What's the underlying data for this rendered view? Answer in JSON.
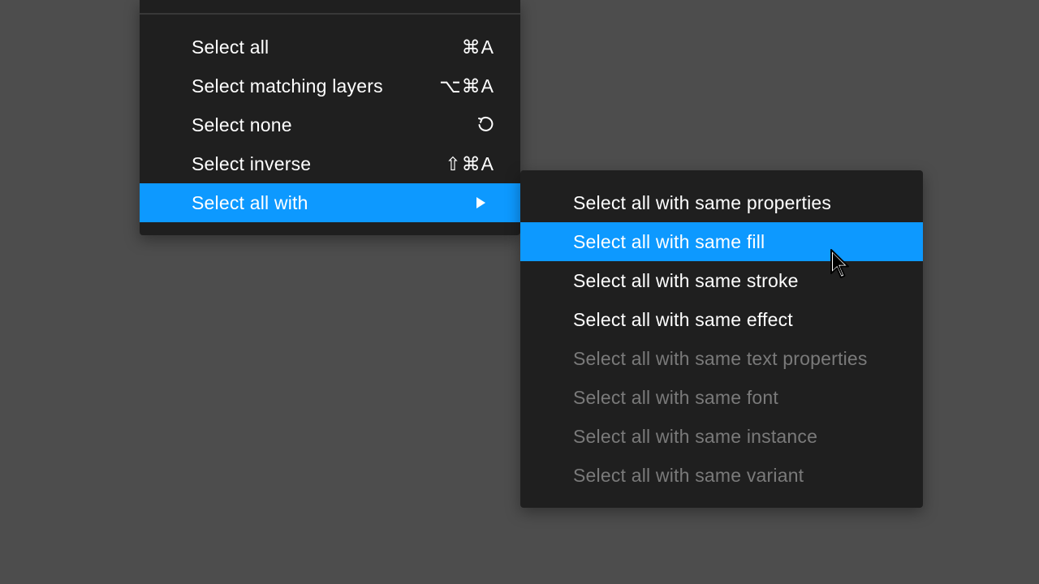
{
  "main_menu": {
    "items": [
      {
        "label": "Select all",
        "shortcut": "⌘A",
        "state": "normal"
      },
      {
        "label": "Select matching layers",
        "shortcut": "⌥⌘A",
        "state": "normal"
      },
      {
        "label": "Select none",
        "shortcut_icon": "undo-icon",
        "state": "normal"
      },
      {
        "label": "Select inverse",
        "shortcut": "⇧⌘A",
        "state": "normal"
      },
      {
        "label": "Select all with",
        "submenu_icon": "triangle-right-icon",
        "state": "highlighted"
      }
    ]
  },
  "submenu": {
    "items": [
      {
        "label": "Select all with same properties",
        "state": "normal"
      },
      {
        "label": "Select all with same fill",
        "state": "highlighted"
      },
      {
        "label": "Select all with same stroke",
        "state": "normal"
      },
      {
        "label": "Select all with same effect",
        "state": "normal"
      },
      {
        "label": "Select all with same text properties",
        "state": "disabled"
      },
      {
        "label": "Select all with same font",
        "state": "disabled"
      },
      {
        "label": "Select all with same instance",
        "state": "disabled"
      },
      {
        "label": "Select all with same variant",
        "state": "disabled"
      }
    ]
  },
  "colors": {
    "background": "#4d4d4d",
    "menu_background": "#1f1f1f",
    "highlight": "#0d99ff",
    "text": "#ffffff",
    "disabled_text": "#7a7a7a"
  },
  "cursor_icon": "arrow-pointer-icon"
}
